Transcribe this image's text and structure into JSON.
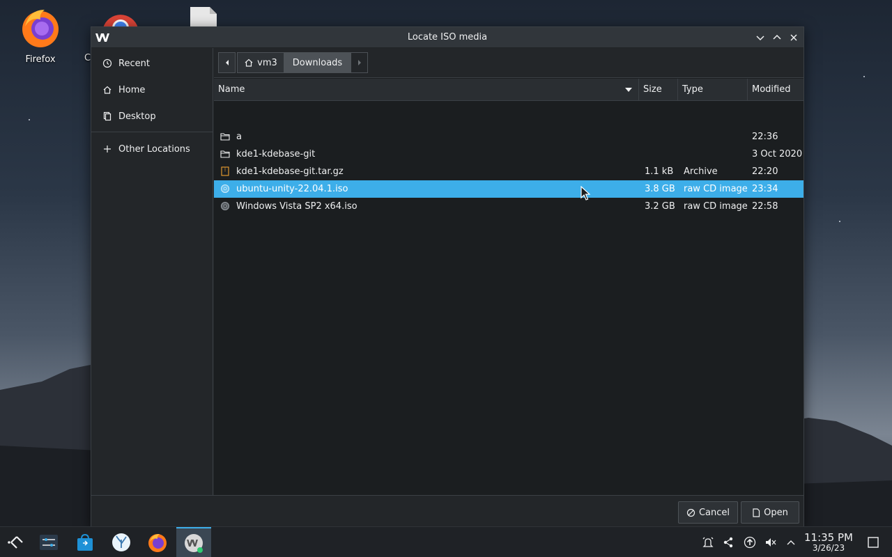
{
  "desktop": {
    "icons": [
      {
        "label": "Firefox"
      },
      {
        "label": "C"
      }
    ]
  },
  "dialog": {
    "title": "Locate ISO media",
    "sidebar": {
      "items": [
        {
          "label": "Recent",
          "icon": "clock-icon"
        },
        {
          "label": "Home",
          "icon": "home-icon"
        },
        {
          "label": "Desktop",
          "icon": "desktop-icon"
        },
        {
          "label": "Other Locations",
          "icon": "plus-icon"
        }
      ]
    },
    "pathbar": {
      "crumbs": [
        {
          "label": "vm3",
          "icon": "home-icon"
        },
        {
          "label": "Downloads"
        }
      ]
    },
    "columns": {
      "name": "Name",
      "size": "Size",
      "type": "Type",
      "modified": "Modified"
    },
    "files": [
      {
        "name": "a",
        "size": "",
        "type": "",
        "modified": "22:36",
        "icon": "folder-icon"
      },
      {
        "name": "kde1-kdebase-git",
        "size": "",
        "type": "",
        "modified": "3 Oct 2020",
        "icon": "folder-icon"
      },
      {
        "name": "kde1-kdebase-git.tar.gz",
        "size": "1.1 kB",
        "type": "Archive",
        "modified": "22:20",
        "icon": "archive-icon"
      },
      {
        "name": "ubuntu-unity-22.04.1.iso",
        "size": "3.8 GB",
        "type": "raw CD image",
        "modified": "23:34",
        "icon": "disc-icon",
        "selected": true
      },
      {
        "name": "Windows Vista SP2 x64.iso",
        "size": "3.2 GB",
        "type": "raw CD image",
        "modified": "22:58",
        "icon": "disc-icon"
      }
    ],
    "buttons": {
      "cancel": "Cancel",
      "open": "Open"
    }
  },
  "taskbar": {
    "clock_time": "11:35 PM",
    "clock_date": "3/26/23"
  },
  "colors": {
    "selection": "#3daee9",
    "dialog_bg": "#232629",
    "list_bg": "#1b1e20"
  }
}
